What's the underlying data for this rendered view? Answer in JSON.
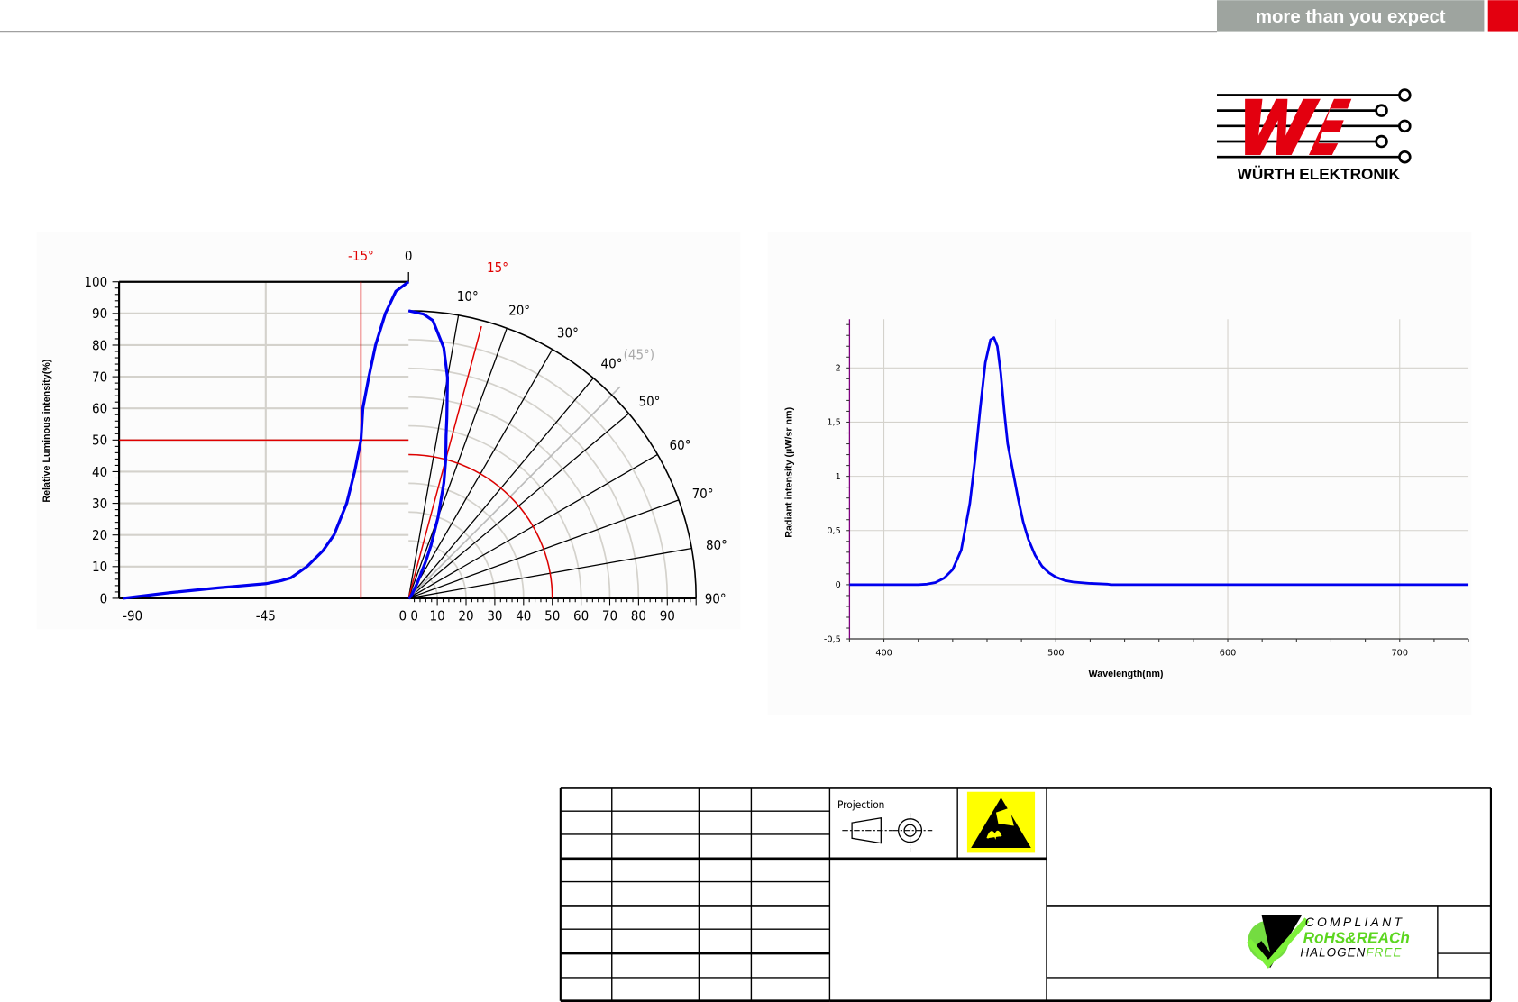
{
  "header": {
    "tagline": "more than you expect"
  },
  "logo": {
    "text": "WÜRTH ELEKTRONIK"
  },
  "colors": {
    "brand_red": "#e3000f",
    "tagline_bg": "#9ea49f",
    "curve_blue": "#0000ee",
    "marker_red": "#e00000",
    "grid": "#d4d2cc",
    "axis_purple": "#800080",
    "esd_yellow": "#ffff00",
    "rohs_green": "#5cd620"
  },
  "chart_data": [
    {
      "type": "line",
      "title": "",
      "ylabel": "Relative Luminous intensity(%)",
      "xlabel": "",
      "ylim": [
        0,
        100
      ],
      "xlim_cartesian": [
        -90,
        0
      ],
      "yticks": [
        "0",
        "10",
        "20",
        "30",
        "40",
        "50",
        "60",
        "70",
        "80",
        "90",
        "100"
      ],
      "xticks_cartesian": [
        "-90",
        "-45",
        "0"
      ],
      "radial_ticks": [
        "0",
        "10",
        "20",
        "30",
        "40",
        "50",
        "60",
        "70",
        "80",
        "90"
      ],
      "top_zero_label": "0",
      "angle_labels": [
        "10°",
        "20°",
        "30°",
        "40°",
        "50°",
        "60°",
        "70°",
        "80°",
        "90°"
      ],
      "angle_values": [
        10,
        20,
        30,
        40,
        50,
        60,
        70,
        80,
        90
      ],
      "half_angle_label_neg": "-15°",
      "half_angle_label_pos": "15°",
      "reference_angle_label": "(45°)",
      "half_intensity": 50,
      "half_angle": 15,
      "grid": true,
      "series": [
        {
          "name": "cartesian",
          "x": [
            -90,
            -75,
            -60,
            -45,
            -40,
            -37,
            -32,
            -27,
            -23.5,
            -19.5,
            -17,
            -15,
            -14.4,
            -12.5,
            -10.4,
            -7.3,
            -4,
            0
          ],
          "y": [
            0,
            1.8,
            3.3,
            4.6,
            5.6,
            6.5,
            10,
            15,
            20,
            30,
            40,
            50,
            60,
            70,
            80,
            90,
            97,
            100
          ]
        },
        {
          "name": "polar",
          "theta": [
            0,
            3,
            5,
            8,
            10,
            12,
            13,
            15,
            17,
            20,
            23,
            25,
            30,
            40,
            60,
            90
          ],
          "r": [
            100,
            99,
            97,
            88,
            78,
            64,
            58,
            50,
            42,
            30,
            20,
            14,
            6,
            2,
            0.5,
            0
          ]
        }
      ]
    },
    {
      "type": "line",
      "title": "",
      "xlabel": "Wavelength(nm)",
      "ylabel": "Radiant intensity (µW/sr nm)",
      "xlim": [
        380,
        740
      ],
      "ylim": [
        -0.5,
        2.45
      ],
      "xticks": [
        400,
        500,
        600,
        700
      ],
      "xtick_labels": [
        "400",
        "500",
        "600",
        "700"
      ],
      "yticks": [
        -0.5,
        0,
        0.5,
        1,
        1.5,
        2
      ],
      "ytick_labels": [
        "-0,5",
        "0",
        "0,5",
        "1",
        "1,5",
        "2"
      ],
      "grid": true,
      "series": [
        {
          "name": "spectrum",
          "x": [
            380,
            420,
            425,
            430,
            435,
            440,
            445,
            450,
            453,
            456,
            459,
            462,
            464,
            466,
            468,
            470,
            472,
            475,
            478,
            481,
            484,
            488,
            492,
            496,
            500,
            505,
            510,
            520,
            530,
            532,
            740
          ],
          "y": [
            0,
            0,
            0.005,
            0.02,
            0.06,
            0.14,
            0.32,
            0.75,
            1.15,
            1.62,
            2.05,
            2.26,
            2.28,
            2.2,
            1.95,
            1.6,
            1.3,
            1.05,
            0.8,
            0.58,
            0.42,
            0.27,
            0.17,
            0.11,
            0.07,
            0.04,
            0.025,
            0.012,
            0.005,
            0,
            0
          ]
        }
      ]
    }
  ],
  "title_block": {
    "projection_label": "Projection",
    "compliance": {
      "line1": "COMPLIANT",
      "line2": "RoHS&REACh",
      "line3a": "HALOGEN",
      "line3b": "FREE"
    }
  }
}
